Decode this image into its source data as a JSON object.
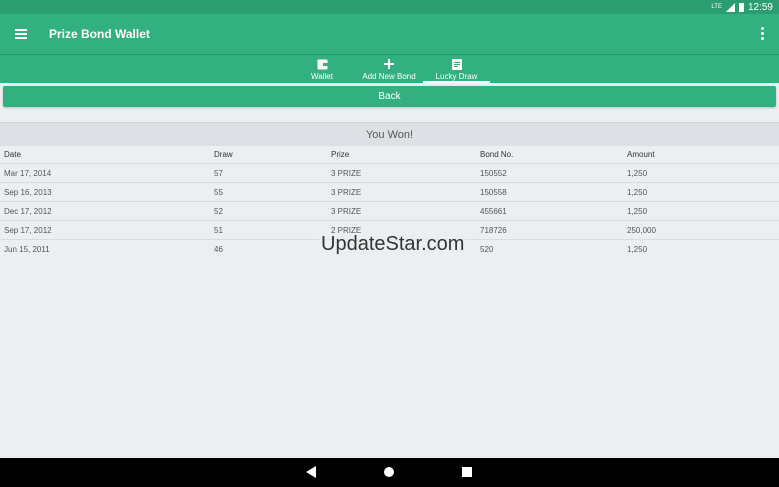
{
  "status_bar": {
    "time": "12:59",
    "network_label": "LTE"
  },
  "app_bar": {
    "title": "Prize Bond Wallet"
  },
  "tabs": [
    {
      "label": "Wallet",
      "icon": "wallet-icon"
    },
    {
      "label": "Add New Bond",
      "icon": "plus-icon"
    },
    {
      "label": "Lucky Draw",
      "icon": "document-icon",
      "active": true
    }
  ],
  "back_button": {
    "label": "Back"
  },
  "result_banner": {
    "text": "You Won!"
  },
  "table": {
    "headers": [
      "Date",
      "Draw",
      "Prize",
      "Bond No.",
      "Amount"
    ],
    "rows": [
      [
        "Mar 17, 2014",
        "57",
        "3 PRIZE",
        "150552",
        "1,250"
      ],
      [
        "Sep 16, 2013",
        "55",
        "3 PRIZE",
        "150558",
        "1,250"
      ],
      [
        "Dec 17, 2012",
        "52",
        "3 PRIZE",
        "455661",
        "1,250"
      ],
      [
        "Sep 17, 2012",
        "51",
        "2 PRIZE",
        "718726",
        "250,000"
      ],
      [
        "Jun 15, 2011",
        "46",
        "",
        "520",
        "1,250"
      ]
    ]
  },
  "watermark": "UpdateStar.com",
  "colors": {
    "primary": "#33b07f",
    "status": "#2a9e70",
    "background": "#eceff1"
  }
}
